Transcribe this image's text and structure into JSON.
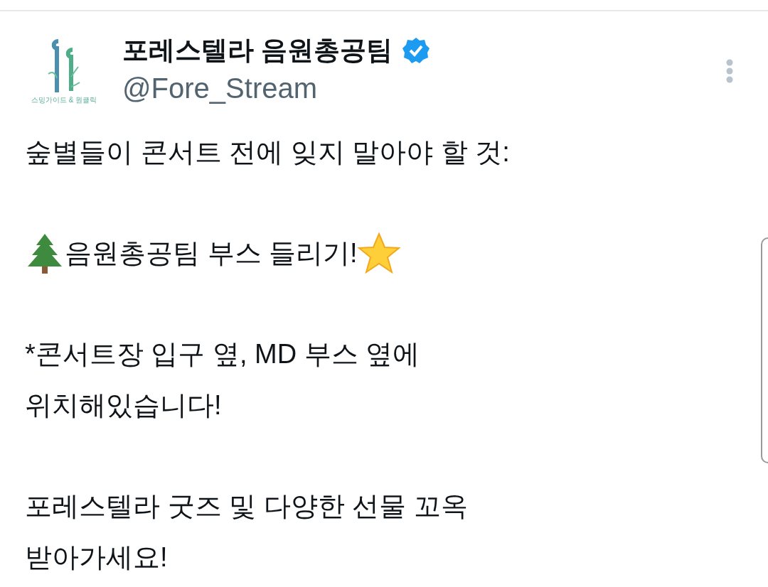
{
  "author": {
    "name": "포레스텔라 음원총공팀",
    "handle": "@Fore_Stream",
    "verified": true,
    "avatar_caption": "스밍가이드 & 원클릭"
  },
  "paragraphs": [
    {
      "kind": "plain",
      "lines": [
        "숲별들이 콘서트 전에 잊지 말아야 할 것:"
      ]
    },
    {
      "kind": "tree-star",
      "lines": [
        "음원총공팀 부스 들리기!"
      ]
    },
    {
      "kind": "plain",
      "lines": [
        "*콘서트장 입구 옆, MD 부스 옆에",
        "위치해있습니다!"
      ]
    },
    {
      "kind": "plain",
      "lines": [
        "포레스텔라 굿즈 및 다양한 선물 꼬옥",
        "받아가세요!"
      ]
    }
  ]
}
